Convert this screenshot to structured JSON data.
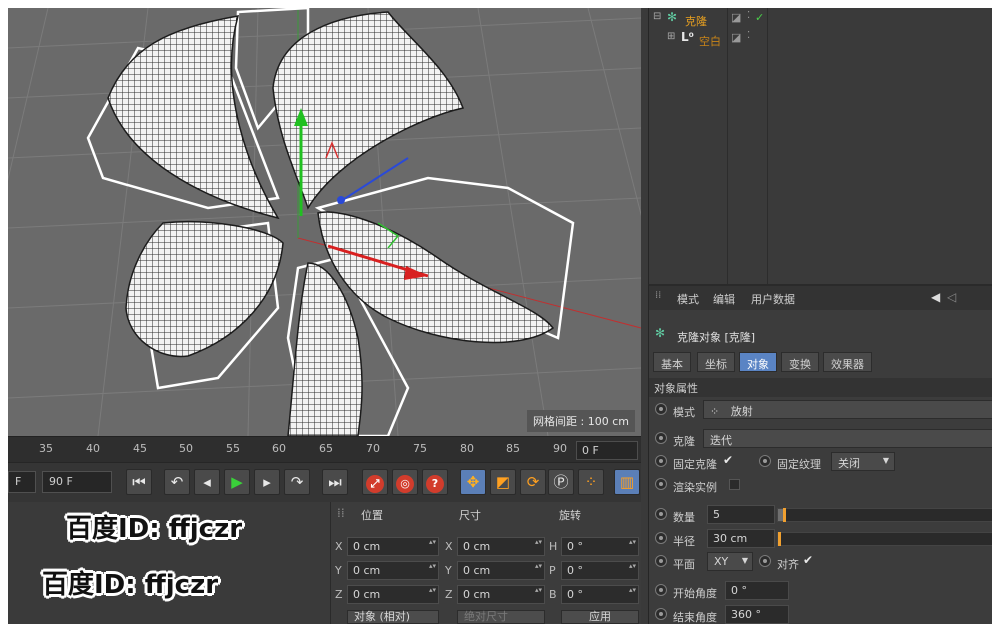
{
  "viewport": {
    "grid_readout": "网格间距 : 100 cm"
  },
  "timeline": {
    "ticks": [
      "35",
      "40",
      "45",
      "50",
      "55",
      "60",
      "65",
      "70",
      "75",
      "80",
      "85",
      "90"
    ],
    "current_frame": "0 F"
  },
  "transport": {
    "start_field": "F",
    "end_field": "90 F"
  },
  "coordinates": {
    "headers": {
      "position": "位置",
      "size": "尺寸",
      "rotation": "旋转"
    },
    "rows": [
      {
        "axis": "X",
        "position": "0 cm",
        "size_axis": "X",
        "size": "0 cm",
        "rot_axis": "H",
        "rotation": "0 °"
      },
      {
        "axis": "Y",
        "position": "0 cm",
        "size_axis": "Y",
        "size": "0 cm",
        "rot_axis": "P",
        "rotation": "0 °"
      },
      {
        "axis": "Z",
        "position": "0 cm",
        "size_axis": "Z",
        "size": "0 cm",
        "rot_axis": "B",
        "rotation": "0 °"
      }
    ],
    "mode_dropdown": "对象 (相对)",
    "size_dropdown": "绝对尺寸",
    "apply_button": "应用"
  },
  "watermarks": [
    "百度ID: ffjczr",
    "百度ID: ffjczr"
  ],
  "object_manager": {
    "items": [
      {
        "name": "克隆",
        "color": "#e8a020"
      },
      {
        "name": "空白",
        "color": "#c88418"
      }
    ]
  },
  "attributes": {
    "menu": [
      "模式",
      "编辑",
      "用户数据"
    ],
    "object_title": "克隆对象 [克隆]",
    "tabs": [
      "基本",
      "坐标",
      "对象",
      "变换",
      "效果器"
    ],
    "active_tab": "对象",
    "section_title": "对象属性",
    "mode_label": "模式",
    "mode_value": "放射",
    "clone_label": "克隆",
    "clone_value": "迭代",
    "fix_clone_label": "固定克隆",
    "fix_texture_label": "固定纹理",
    "fix_texture_value": "关闭",
    "render_instance_label": "渲染实例",
    "count_label": "数量",
    "count_value": "5",
    "count_fraction": 0.03,
    "radius_label": "半径",
    "radius_value": "30 cm",
    "radius_fraction": 0.0,
    "plane_label": "平面",
    "plane_value": "XY",
    "align_label": "对齐",
    "start_angle_label": "开始角度",
    "start_angle_value": "0 °",
    "end_angle_label": "结束角度",
    "end_angle_value": "360 °"
  },
  "colors": {
    "accent_blue": "#5a84c4",
    "slider_knob": "#f0a030",
    "viewport_bg": "#6a6a6a"
  }
}
